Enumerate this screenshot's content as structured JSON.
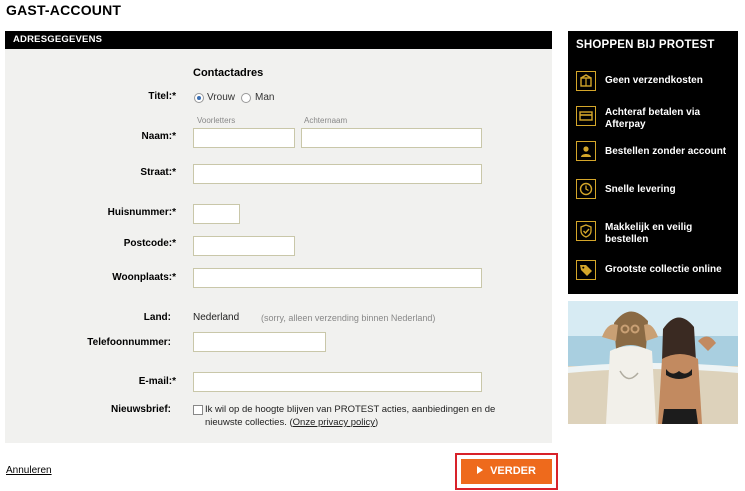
{
  "page": {
    "title": "GAST-ACCOUNT"
  },
  "panel": {
    "header": "ADRESGEGEVENS",
    "section_title": "Contactadres"
  },
  "form": {
    "titel_label": "Titel:*",
    "titel_options": [
      {
        "label": "Vrouw",
        "selected": true
      },
      {
        "label": "Man",
        "selected": false
      }
    ],
    "naam_label": "Naam:*",
    "voorletters_sublabel": "Voorletters",
    "achternaam_sublabel": "Achternaam",
    "straat_label": "Straat:*",
    "huisnummer_label": "Huisnummer:*",
    "postcode_label": "Postcode:*",
    "woonplaats_label": "Woonplaats:*",
    "land_label": "Land:",
    "land_value": "Nederland",
    "land_note": "(sorry, alleen verzending binnen Nederland)",
    "telefoon_label": "Telefoonnummer:",
    "email_label": "E-mail:*",
    "nieuwsbrief_label": "Nieuwsbrief:",
    "nieuwsbrief_text": "Ik wil op de hoogte blijven van PROTEST acties, aanbiedingen en de nieuwste collecties. (",
    "privacy_link": "Onze privacy policy",
    "nieuwsbrief_suffix": ")",
    "nieuwsbrief_checked": false
  },
  "actions": {
    "cancel": "Annuleren",
    "next": "VERDER"
  },
  "side": {
    "title": "SHOPPEN BIJ PROTEST",
    "benefits": [
      {
        "label": "Geen verzendkosten",
        "icon": "box-icon"
      },
      {
        "label": "Achteraf betalen via Afterpay",
        "icon": "card-icon"
      },
      {
        "label": "Bestellen zonder account",
        "icon": "person-icon"
      },
      {
        "label": "Snelle levering",
        "icon": "clock-icon"
      },
      {
        "label": "Makkelijk en veilig bestellen",
        "icon": "shield-check-icon"
      },
      {
        "label": "Grootste collectie online",
        "icon": "tag-icon"
      }
    ]
  },
  "colors": {
    "accent": "#ee6a1c",
    "highlight": "#d8222a",
    "gold": "#d4a62a",
    "panel_bg": "#f1f1ef"
  }
}
